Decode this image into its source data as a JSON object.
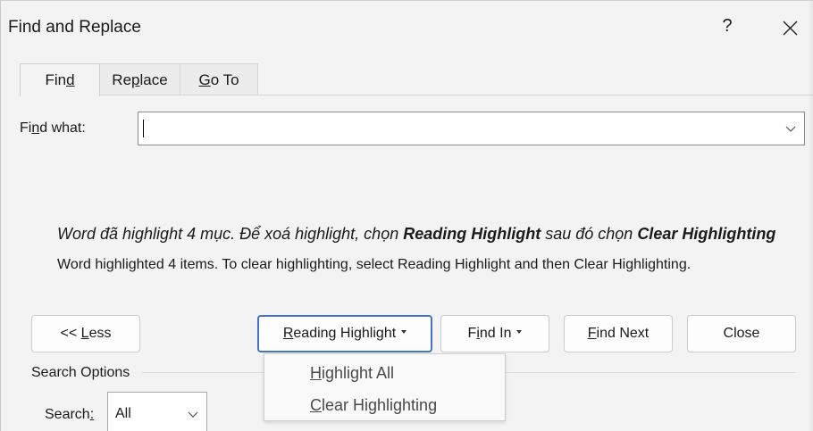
{
  "dialog": {
    "title": "Find and Replace",
    "help_label": "?",
    "close_icon": "close-icon"
  },
  "tabs": [
    {
      "pre": "Fin",
      "ul": "d",
      "post": "",
      "active": true
    },
    {
      "pre": "Re",
      "ul": "p",
      "post": "lace",
      "active": false
    },
    {
      "pre": "",
      "ul": "G",
      "post": "o To",
      "active": false
    }
  ],
  "find": {
    "label_pre": "Fi",
    "label_ul": "n",
    "label_post": "d what:",
    "value": ""
  },
  "message": {
    "vi_part1": "Word đã highlight 4 mục. Để xoá highlight, chọn ",
    "vi_bold1": "Reading Highlight",
    "vi_part2": " sau đó chọn ",
    "vi_bold2": "Clear Highlighting",
    "en": "Word highlighted 4 items. To clear highlighting, select Reading Highlight and then Clear Highlighting."
  },
  "buttons": {
    "less": {
      "pre": "<< ",
      "ul": "L",
      "post": "ess"
    },
    "reading_highlight": {
      "pre": "",
      "ul": "R",
      "post": "eading Highlight"
    },
    "find_in": {
      "pre": "F",
      "ul": "i",
      "post": "nd In"
    },
    "find_next": {
      "pre": "",
      "ul": "F",
      "post": "ind Next"
    },
    "close": {
      "label": "Close"
    }
  },
  "search_options": {
    "heading": "Search Options",
    "search_label_pre": "Search",
    "search_label_ul": ":",
    "search_value": "All"
  },
  "menu": {
    "items": [
      {
        "pre": "",
        "ul": "H",
        "post": "ighlight All"
      },
      {
        "pre": "",
        "ul": "C",
        "post": "lear Highlighting"
      }
    ]
  },
  "colors": {
    "focus_border": "#4472c4",
    "dialog_bg": "#f3f3f3"
  }
}
